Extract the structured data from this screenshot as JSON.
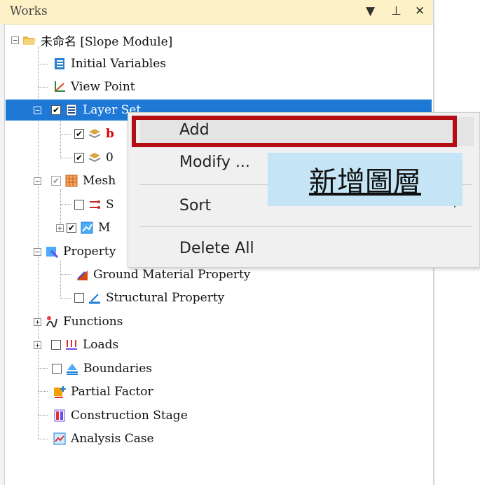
{
  "panel": {
    "title": "Works",
    "dropdown_glyph": "▼",
    "pin_glyph": "⊥",
    "close_glyph": "✕"
  },
  "tree": {
    "root": "未命名 [Slope Module]",
    "initial_variables": "Initial Variables",
    "view_point": "View Point",
    "layer_set": "Layer Set",
    "layer_1": "b",
    "layer_2": "0",
    "mesh": "Mesh",
    "mesh_child_1": "S",
    "mesh_child_2": "M",
    "property": "Property",
    "ground_material": "Ground Material Property",
    "structural_property": "Structural Property",
    "functions": "Functions",
    "loads": "Loads",
    "boundaries": "Boundaries",
    "partial_factor": "Partial Factor",
    "construction_stage": "Construction Stage",
    "analysis_case": "Analysis Case"
  },
  "context_menu": {
    "add": "Add",
    "modify": "Modify ...",
    "sort": "Sort",
    "sort_arrow": "›",
    "delete_all": "Delete All"
  },
  "callout": {
    "text": "新增圖層"
  },
  "colors": {
    "selection": "#1d78d6",
    "highlight_border": "#b40d13",
    "callout_bg": "#c5e5f6",
    "titlebar": "#fdf2c7"
  }
}
